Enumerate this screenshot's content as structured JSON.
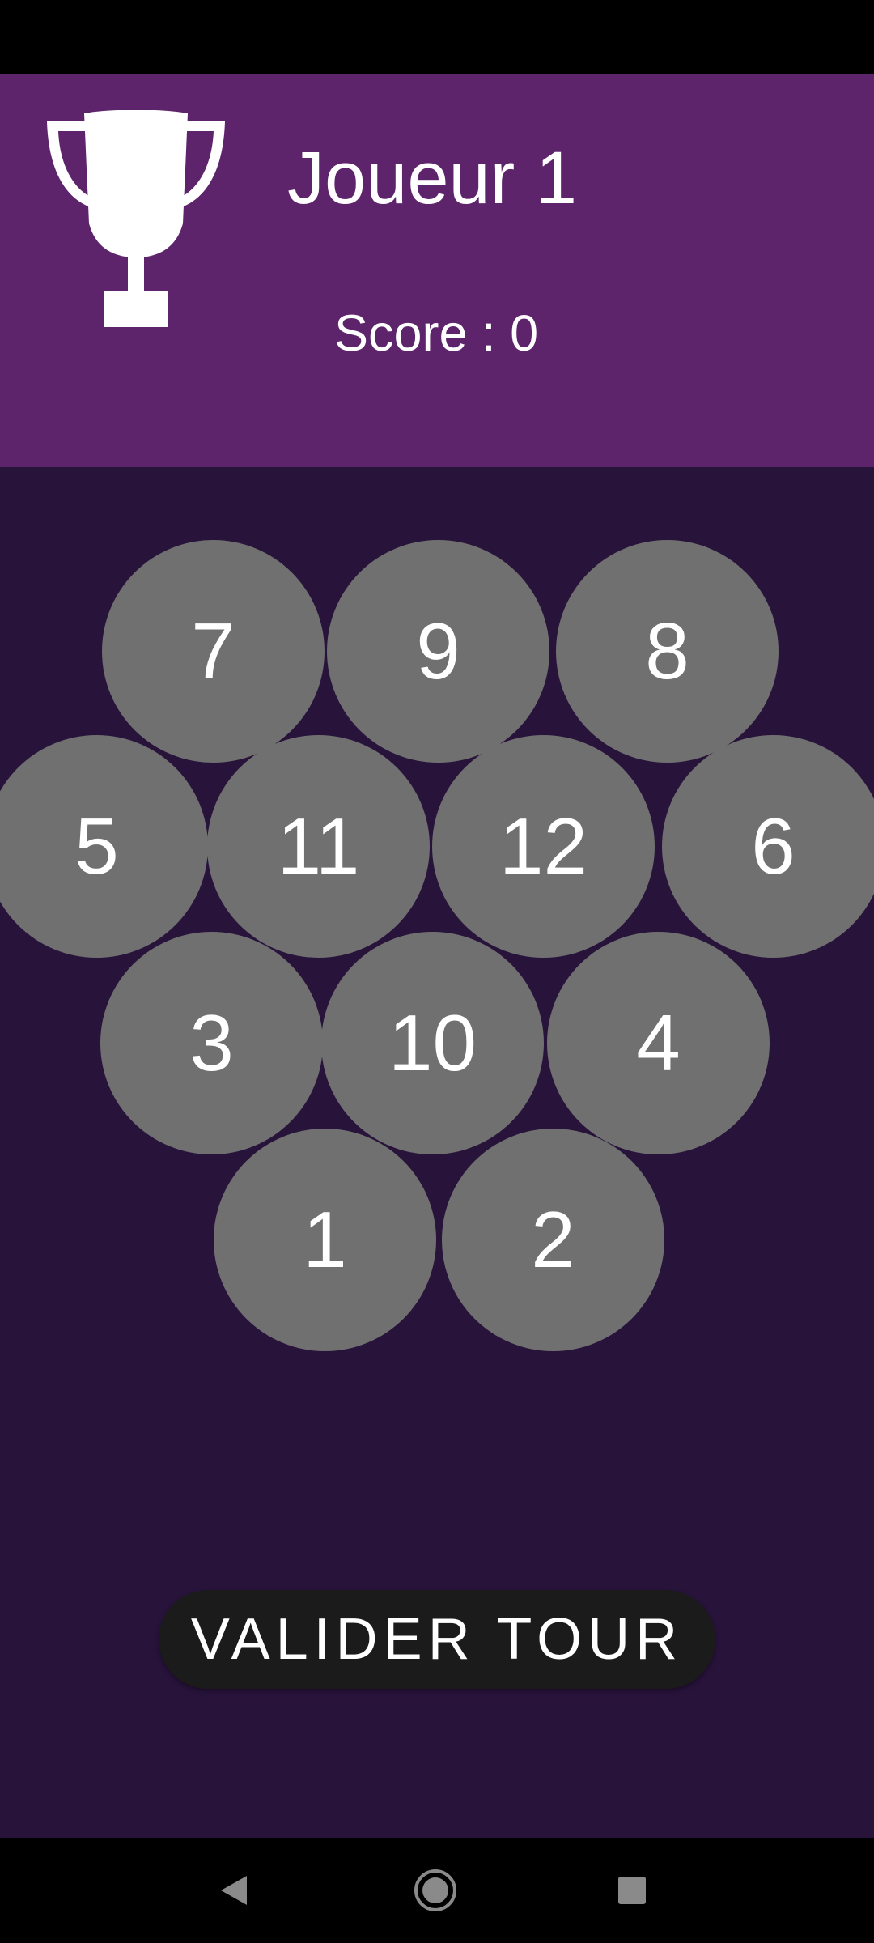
{
  "header": {
    "player_name": "Joueur 1",
    "score_label": "Score : 0"
  },
  "pins": [
    {
      "label": "7"
    },
    {
      "label": "9"
    },
    {
      "label": "8"
    },
    {
      "label": "5"
    },
    {
      "label": "11"
    },
    {
      "label": "12"
    },
    {
      "label": "6"
    },
    {
      "label": "3"
    },
    {
      "label": "10"
    },
    {
      "label": "4"
    },
    {
      "label": "1"
    },
    {
      "label": "2"
    }
  ],
  "actions": {
    "validate_label": "VALIDER TOUR"
  },
  "icons": {
    "trophy": "trophy-icon",
    "back": "back-icon",
    "home": "home-icon",
    "recents": "recents-icon"
  },
  "colors": {
    "header_bg": "#5d246b",
    "board_bg": "#28133b",
    "pin_bg": "#707070",
    "button_bg": "#1b1b1b"
  }
}
